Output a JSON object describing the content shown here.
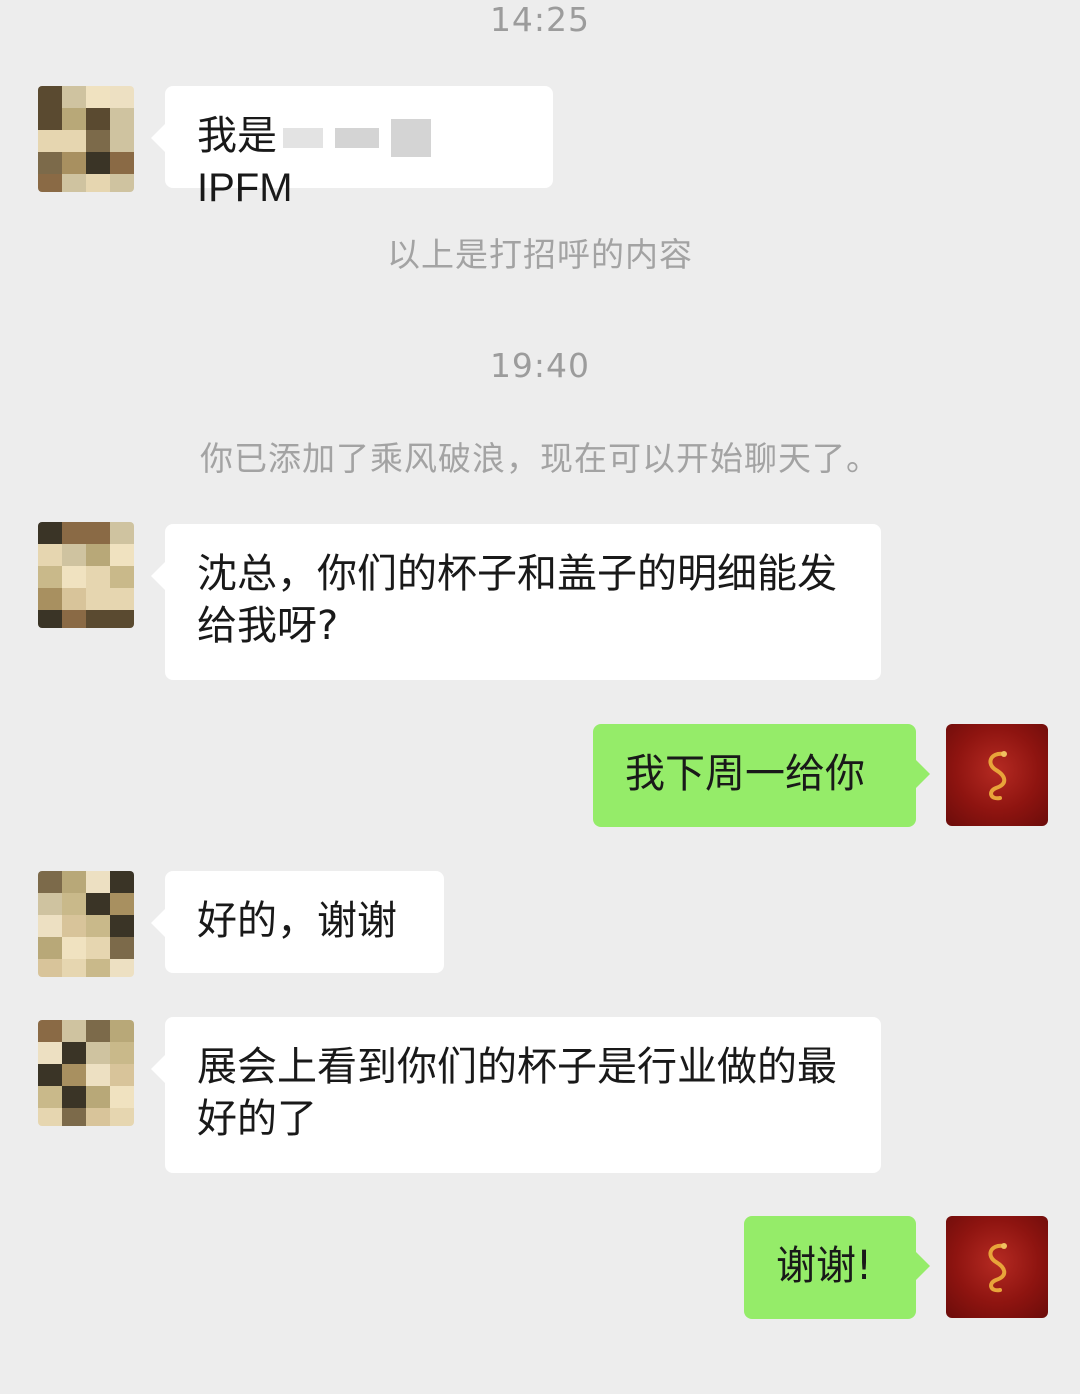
{
  "timestamps": [
    "14:25",
    "19:40"
  ],
  "system_messages": {
    "greeting_note": "以上是打招呼的内容",
    "added_note": "你已添加了乘风破浪，现在可以开始聊天了。"
  },
  "messages": [
    {
      "from": "contact",
      "text_before": "我是",
      "text_after": "IPFM"
    },
    {
      "from": "contact",
      "text": "沈总，你们的杯子和盖子的明细能发给我呀?"
    },
    {
      "from": "me",
      "text": "我下周一给你"
    },
    {
      "from": "contact",
      "text": "好的，谢谢"
    },
    {
      "from": "contact",
      "text": "展会上看到你们的杯子是行业做的最好的了"
    },
    {
      "from": "me",
      "text": "谢谢!"
    }
  ],
  "avatars": {
    "contact": "blurred-avatar",
    "me": "red-dragon-avatar"
  },
  "colors": {
    "background": "#ededed",
    "incoming_bubble": "#ffffff",
    "outgoing_bubble": "#95ec69",
    "meta_text": "#9c9c9c"
  }
}
